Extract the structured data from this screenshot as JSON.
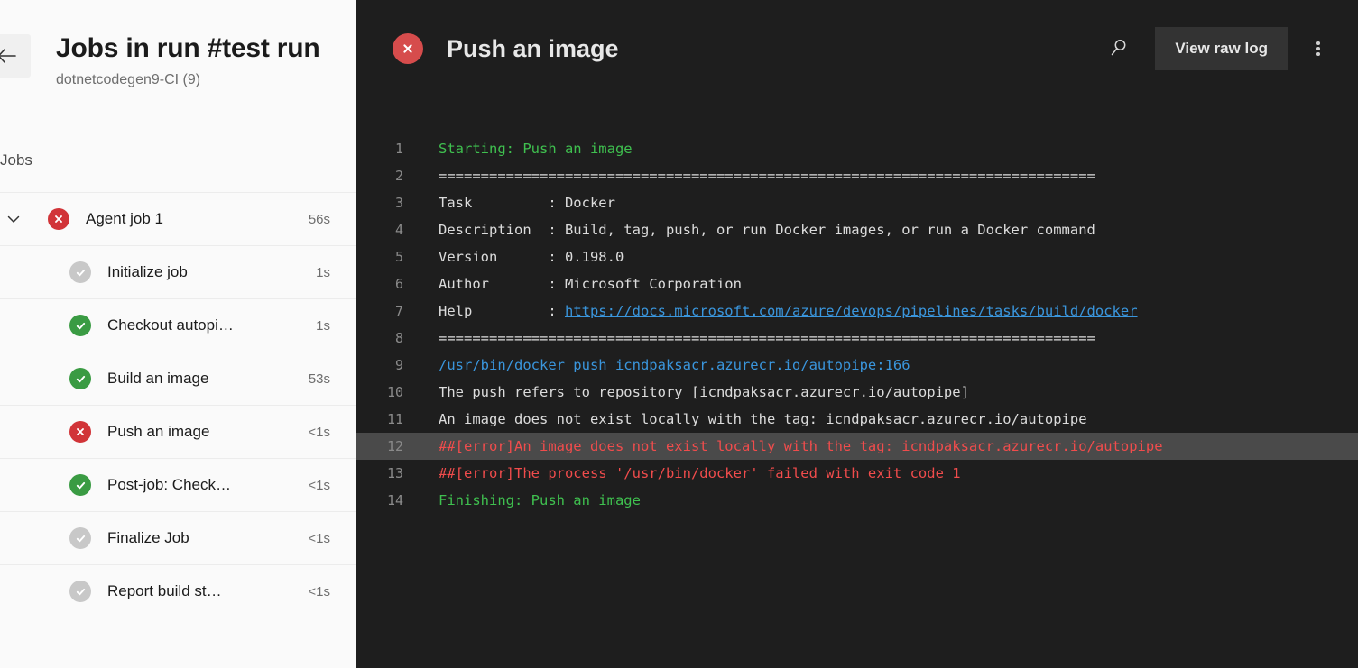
{
  "sidebar": {
    "back_label": "Back",
    "title": "Jobs in run #test run",
    "subtitle": "dotnetcodegen9-CI (9)",
    "section_label": "Jobs",
    "jobs": [
      {
        "name": "Agent job 1",
        "duration": "56s",
        "status": "failed",
        "level": "parent"
      },
      {
        "name": "Initialize job",
        "duration": "1s",
        "status": "skipped",
        "level": "child"
      },
      {
        "name": "Checkout autopi…",
        "duration": "1s",
        "status": "succeeded",
        "level": "child"
      },
      {
        "name": "Build an image",
        "duration": "53s",
        "status": "succeeded",
        "level": "child"
      },
      {
        "name": "Push an image",
        "duration": "<1s",
        "status": "failed",
        "level": "child"
      },
      {
        "name": "Post-job: Check…",
        "duration": "<1s",
        "status": "succeeded",
        "level": "child"
      },
      {
        "name": "Finalize Job",
        "duration": "<1s",
        "status": "skipped",
        "level": "child"
      },
      {
        "name": "Report build st…",
        "duration": "<1s",
        "status": "skipped",
        "level": "child"
      }
    ]
  },
  "log": {
    "header": {
      "status": "failed",
      "title": "Push an image",
      "search_label": "Search",
      "raw_log_label": "View raw log",
      "more_label": "More actions"
    },
    "lines": [
      {
        "n": "1",
        "text": "Starting: Push an image",
        "color": "c-green"
      },
      {
        "n": "2",
        "text": "==============================================================================",
        "color": "c-white"
      },
      {
        "n": "3",
        "text": "Task         : Docker",
        "color": "c-white"
      },
      {
        "n": "4",
        "text": "Description  : Build, tag, push, or run Docker images, or run a Docker command",
        "color": "c-white"
      },
      {
        "n": "5",
        "text": "Version      : 0.198.0",
        "color": "c-white"
      },
      {
        "n": "6",
        "text": "Author       : Microsoft Corporation",
        "color": "c-white"
      },
      {
        "n": "7",
        "prefix": "Help         : ",
        "link": "https://docs.microsoft.com/azure/devops/pipelines/tasks/build/docker",
        "color": "c-white"
      },
      {
        "n": "8",
        "text": "==============================================================================",
        "color": "c-white"
      },
      {
        "n": "9",
        "text": "/usr/bin/docker push icndpaksacr.azurecr.io/autopipe:166",
        "color": "c-cyan"
      },
      {
        "n": "10",
        "text": "The push refers to repository [icndpaksacr.azurecr.io/autopipe]",
        "color": "c-white"
      },
      {
        "n": "11",
        "text": "An image does not exist locally with the tag: icndpaksacr.azurecr.io/autopipe",
        "color": "c-white"
      },
      {
        "n": "12",
        "text": "##[error]An image does not exist locally with the tag: icndpaksacr.azurecr.io/autopipe",
        "color": "c-red",
        "highlight": true,
        "redacted": true
      },
      {
        "n": "13",
        "text": "##[error]The process '/usr/bin/docker' failed with exit code 1",
        "color": "c-red"
      },
      {
        "n": "14",
        "text": "Finishing: Push an image",
        "color": "c-green"
      }
    ]
  },
  "colors": {
    "failed": "#d13438",
    "succeeded": "#3a9b43",
    "skipped": "#c8c8c8",
    "redaction": "#e81123",
    "log_bg": "#1e1e1e",
    "highlight_bg": "#4a4a4a"
  }
}
